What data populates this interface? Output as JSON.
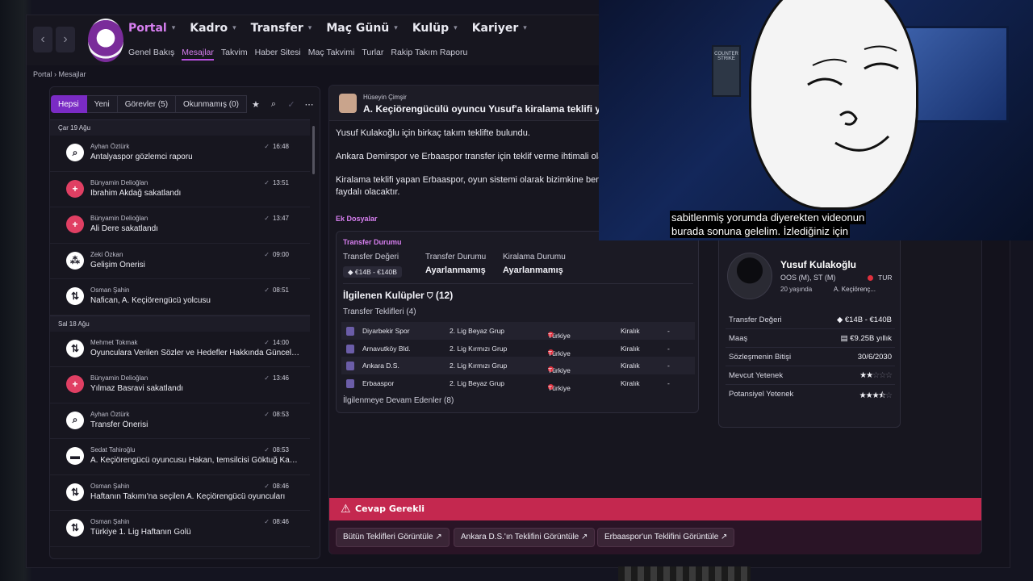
{
  "header": {
    "menu": [
      {
        "label": "Portal",
        "active": true
      },
      {
        "label": "Kadro"
      },
      {
        "label": "Transfer"
      },
      {
        "label": "Maç Günü"
      },
      {
        "label": "Kulüp"
      },
      {
        "label": "Kariyer"
      }
    ],
    "submenu": [
      "Genel Bakış",
      "Mesajlar",
      "Takvim",
      "Haber Sitesi",
      "Maç Takvimi",
      "Turlar",
      "Rakip Takım Raporu"
    ],
    "breadcrumb": {
      "root": "Portal",
      "current": "Mesajlar"
    }
  },
  "filters": {
    "all": "Hepsi",
    "new": "Yeni",
    "tasks": "Görevler (5)",
    "unread": "Okunmamış (0)"
  },
  "inbox": {
    "days": [
      {
        "label": "Çar 19 Ağu",
        "messages": [
          {
            "from": "Ayhan Öztürk",
            "subject": "Antalyaspor gözlemci raporu",
            "time": "16:48",
            "icon": "magnifier-icon"
          },
          {
            "from": "Bünyamin Delioğlan",
            "subject": "İbrahim Akdağ sakatlandı",
            "time": "13:51",
            "icon": "medical-cross-icon"
          },
          {
            "from": "Bünyamin Delioğlan",
            "subject": "Ali Dere sakatlandı",
            "time": "13:47",
            "icon": "medical-cross-icon"
          },
          {
            "from": "Zeki Özkan",
            "subject": "Gelişim Önerisi",
            "time": "09:00",
            "icon": "group-icon"
          },
          {
            "from": "Osman Şahin",
            "subject": "Nafican, A. Keçiörengücü yolcusu",
            "time": "08:51",
            "icon": "transfer-icon"
          }
        ]
      },
      {
        "label": "Sal 18 Ağu",
        "messages": [
          {
            "from": "Mehmet Tokmak",
            "subject": "Oyunculara Verilen Sözler ve Hedefler Hakkında Güncel Rapor",
            "time": "14:00",
            "icon": "transfer-icon"
          },
          {
            "from": "Bünyamin Delioğlan",
            "subject": "Yılmaz Basravi sakatlandı",
            "time": "13:46",
            "icon": "medical-cross-icon"
          },
          {
            "from": "Ayhan Öztürk",
            "subject": "Transfer Önerisi",
            "time": "08:53",
            "icon": "magnifier-icon"
          },
          {
            "from": "Sedat Tahiroğlu",
            "subject": "A. Keçiörengücü oyuncusu Hakan, temsilcisi Göktuğ Kaya ile anlaştı",
            "time": "08:53",
            "icon": "briefcase-icon"
          },
          {
            "from": "Osman Şahin",
            "subject": "Haftanın Takımı'na seçilen A. Keçiörengücü oyuncuları",
            "time": "08:46",
            "icon": "transfer-icon"
          },
          {
            "from": "Osman Şahin",
            "subject": "Türkiye 1. Lig Haftanın Golü",
            "time": "08:46",
            "icon": "transfer-icon"
          }
        ]
      }
    ]
  },
  "message": {
    "sender": "Hüseyin Çimşir",
    "title": "A. Keçiörengücülü oyuncu Yusuf'a kiralama teklifi yap",
    "paragraphs": [
      "Yusuf Kulakoğlu için birkaç takım teklifte bulundu.",
      "Ankara Demirspor ve Erbaaspor transfer için teklif verme ihtimali ola",
      "Kiralama teklifi yapan Erbaaspor, oyun sistemi olarak bizimkine ben",
      "faydalı olacaktır."
    ],
    "attachments_label": "Ek Dosyalar",
    "transfer_card": {
      "heading": "Transfer Durumu",
      "value_label": "Transfer Değeri",
      "value": "€14B - €140B",
      "status_label": "Transfer Durumu",
      "status": "Ayarlanmamış",
      "loan_label": "Kiralama Durumu",
      "loan": "Ayarlanmamış",
      "interested_title": "İlgilenen Kulüpler",
      "interested_count": "(12)",
      "offers_label": "Transfer Teklifleri (4)",
      "clubs": [
        {
          "name": "Diyarbekir Spor",
          "league": "2. Lig Beyaz Grup",
          "country": "Türkiye",
          "type": "Kiralık",
          "extra": "-"
        },
        {
          "name": "Arnavutköy Bld.",
          "league": "2. Lig Kırmızı Grup",
          "country": "Türkiye",
          "type": "Kiralık",
          "extra": "-"
        },
        {
          "name": "Ankara D.S.",
          "league": "2. Lig Kırmızı Grup",
          "country": "Türkiye",
          "type": "Kiralık",
          "extra": "-"
        },
        {
          "name": "Erbaaspor",
          "league": "2. Lig Beyaz Grup",
          "country": "Türkiye",
          "type": "Kiralık",
          "extra": "-"
        }
      ],
      "continuing_label": "İlgilenmeye Devam Edenler (8)"
    },
    "player_card": {
      "name": "Yusuf Kulakoğlu",
      "position": "OOS (M), ST (M)",
      "nationality": "TUR",
      "age": "20 yaşında",
      "club": "A. Keçiörenç...",
      "rows": [
        {
          "key": "Transfer Değeri",
          "value": "€14B - €140B"
        },
        {
          "key": "Maaş",
          "value": "€9.25B yıllık"
        },
        {
          "key": "Sözleşmenin Bitişi",
          "value": "30/6/2030"
        }
      ],
      "ability_label": "Mevcut Yetenek",
      "ability_stars": 2,
      "potential_label": "Potansiyel Yetenek",
      "potential_stars": 3.5
    }
  },
  "footer": {
    "alert": "Cevap Gerekli",
    "buttons": [
      "Bütün Teklifleri Görüntüle",
      "Ankara D.S.'ın Teklifini Görüntüle",
      "Erbaaspor'un Teklifini Görüntüle"
    ]
  },
  "overlay": {
    "poster_text": "COUNTER STRIKE",
    "subtitle_line1": "sabitlenmiş yorumda diyerekten videonun",
    "subtitle_line2": "burada sonuna gelelim. İzlediğiniz için"
  },
  "colors": {
    "accent": "#b94fe0",
    "alert": "#c4284f",
    "panel": "#17161f"
  }
}
